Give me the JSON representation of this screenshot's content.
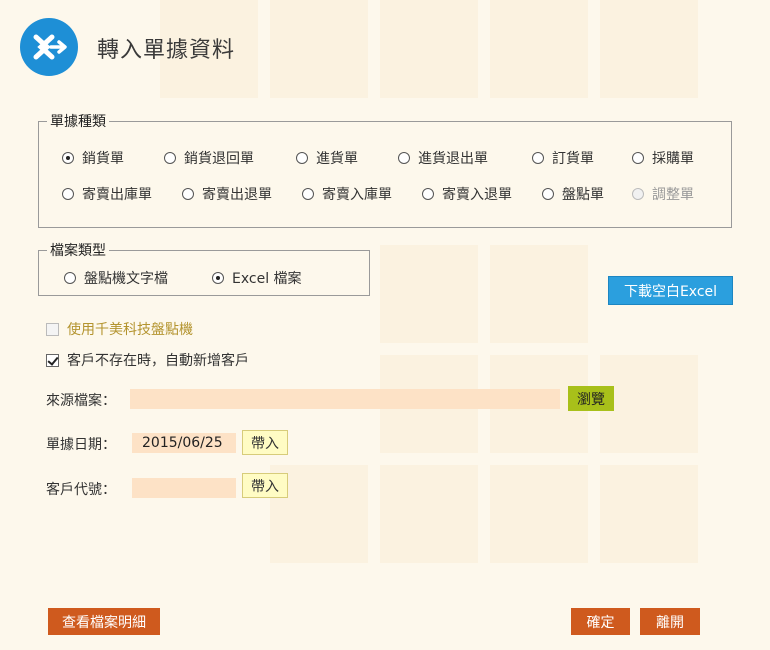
{
  "dialog": {
    "title": "轉入單據資料",
    "logo_icon": "transfer-logo-icon"
  },
  "doc_type": {
    "legend": "單據種類",
    "options": [
      {
        "label": "銷貨單",
        "checked": true,
        "disabled": false
      },
      {
        "label": "銷貨退回單",
        "checked": false,
        "disabled": false
      },
      {
        "label": "進貨單",
        "checked": false,
        "disabled": false
      },
      {
        "label": "進貨退出單",
        "checked": false,
        "disabled": false
      },
      {
        "label": "訂貨單",
        "checked": false,
        "disabled": false
      },
      {
        "label": "採購單",
        "checked": false,
        "disabled": false
      },
      {
        "label": "寄賣出庫單",
        "checked": false,
        "disabled": false
      },
      {
        "label": "寄賣出退單",
        "checked": false,
        "disabled": false
      },
      {
        "label": "寄賣入庫單",
        "checked": false,
        "disabled": false
      },
      {
        "label": "寄賣入退單",
        "checked": false,
        "disabled": false
      },
      {
        "label": "盤點單",
        "checked": false,
        "disabled": false
      },
      {
        "label": "調整單",
        "checked": false,
        "disabled": true
      }
    ]
  },
  "file_type": {
    "legend": "檔案類型",
    "options": [
      {
        "label": "盤點機文字檔",
        "checked": false
      },
      {
        "label": "Excel 檔案",
        "checked": true
      }
    ]
  },
  "download_button": "下載空白Excel",
  "checkboxes": {
    "scanner": {
      "label": "使用千美科技盤點機",
      "checked": false,
      "disabled": true
    },
    "auto_customer": {
      "label": "客戶不存在時，自動新增客戶",
      "checked": true,
      "disabled": false
    }
  },
  "fields": {
    "source_file": {
      "label": "來源檔案：",
      "value": "",
      "button": "瀏覽"
    },
    "doc_date": {
      "label": "單據日期：",
      "value": "2015/06/25",
      "button": "帶入"
    },
    "customer_code": {
      "label": "客戶代號：",
      "value": "",
      "button": "帶入"
    }
  },
  "footer": {
    "view_detail": "查看檔案明細",
    "confirm": "確定",
    "leave": "離開"
  },
  "colors": {
    "background": "#fdf8ec",
    "logo": "#1e8fd6",
    "primary_blue": "#2b9fde",
    "browse_green": "#a8c01a",
    "action_orange": "#cf5a1e",
    "input_fill": "#fde2c6",
    "insert_yellow": "#fffcc4"
  }
}
